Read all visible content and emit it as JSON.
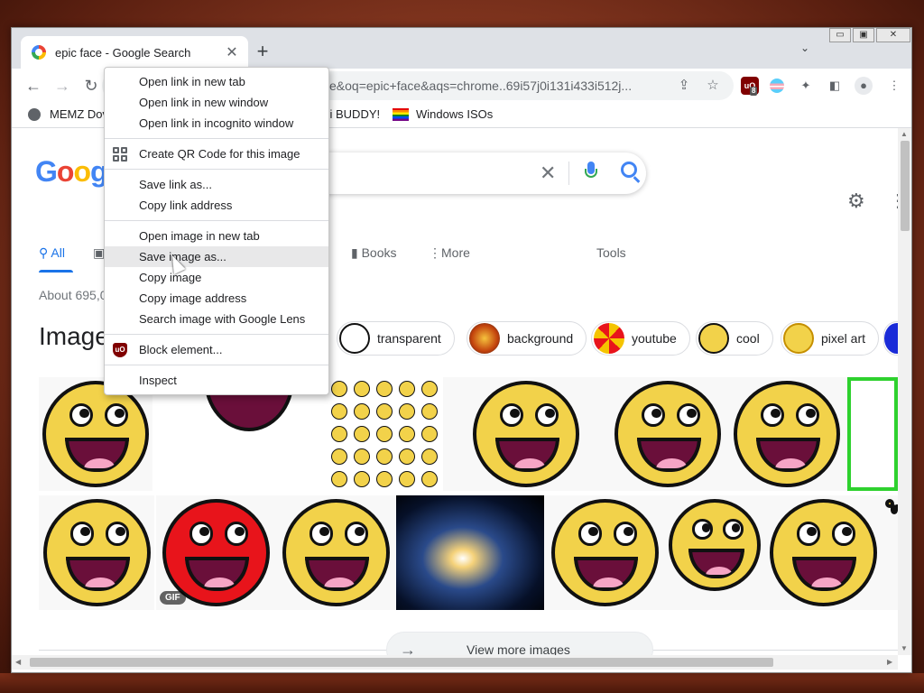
{
  "browser": {
    "tab": {
      "title": "epic face - Google Search",
      "close": "✕"
    },
    "new_tab": "+",
    "tab_search": "⌄",
    "window_controls": {
      "minimize": "▭",
      "restore": "▣",
      "close": "✕"
    },
    "toolbar": {
      "back": "←",
      "forward": "→",
      "reload": "↻",
      "url_visible": "ce&oq=epic+face&aqs=chrome..69i57j0i131i433i512j...",
      "ublock_label": "uO",
      "ublock_badge": "8"
    },
    "bookmarks": [
      {
        "label": "MEMZ Dov"
      },
      {
        "label": "zi BUDDY!"
      },
      {
        "label": "Windows ISOs"
      }
    ]
  },
  "search": {
    "logo_text": "Goog",
    "clear": "✕",
    "nav_tabs": [
      {
        "label": "All",
        "active": true
      },
      {
        "label": "Books"
      },
      {
        "label": "More"
      },
      {
        "label": "Tools"
      }
    ],
    "result_count": "About 695,0",
    "images_heading": "Image",
    "chips": [
      {
        "label": "transparent"
      },
      {
        "label": "background"
      },
      {
        "label": "youtube"
      },
      {
        "label": "cool"
      },
      {
        "label": "pixel art"
      }
    ],
    "gif_badge": "GIF",
    "view_more": "View more images"
  },
  "context_menu": {
    "items": [
      {
        "label": "Open link in new tab"
      },
      {
        "label": "Open link in new window"
      },
      {
        "label": "Open link in incognito window"
      },
      {
        "label": "Create QR Code for this image",
        "icon": "qr-code-icon"
      },
      {
        "label": "Save link as..."
      },
      {
        "label": "Copy link address"
      },
      {
        "label": "Open image in new tab"
      },
      {
        "label": "Save image as...",
        "hovered": true
      },
      {
        "label": "Copy image"
      },
      {
        "label": "Copy image address"
      },
      {
        "label": "Search image with Google Lens"
      },
      {
        "label": "Block element...",
        "icon": "ublock-icon",
        "icon_text": "uO"
      },
      {
        "label": "Inspect"
      }
    ]
  },
  "colors": {
    "google_blue": "#4285f4",
    "face_yellow": "#f2d24a",
    "face_red": "#e8141b",
    "menu_hover": "#e8e8e9"
  }
}
